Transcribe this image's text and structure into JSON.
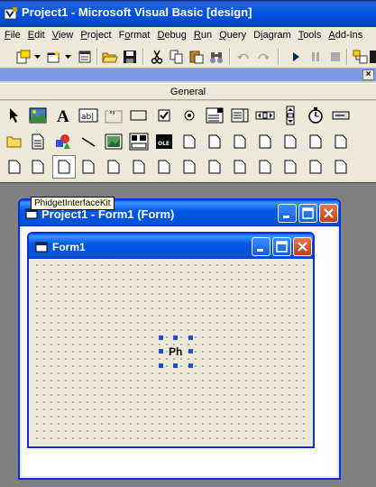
{
  "window": {
    "title": "Project1 - Microsoft Visual Basic [design]"
  },
  "menu": {
    "items": [
      {
        "label": "File",
        "ul": "F",
        "rest": "ile"
      },
      {
        "label": "Edit",
        "ul": "E",
        "rest": "dit"
      },
      {
        "label": "View",
        "ul": "V",
        "rest": "iew"
      },
      {
        "label": "Project",
        "ul": "P",
        "rest": "roject"
      },
      {
        "label": "Format",
        "ul": "o",
        "pre": "F",
        "rest": "rmat"
      },
      {
        "label": "Debug",
        "ul": "D",
        "rest": "ebug"
      },
      {
        "label": "Run",
        "ul": "R",
        "rest": "un"
      },
      {
        "label": "Query",
        "ul": "Q",
        "rest": "uery"
      },
      {
        "label": "Diagram",
        "ul": "i",
        "pre": "D",
        "rest": "agram"
      },
      {
        "label": "Tools",
        "ul": "T",
        "rest": "ools"
      },
      {
        "label": "Add-Ins",
        "ul": "A",
        "rest": "dd-Ins"
      }
    ]
  },
  "toolbox": {
    "tab_label": "General",
    "close_label": "×",
    "tooltip": "PhidgetInterfaceKit"
  },
  "project_window": {
    "title": "Project1 - Form1 (Form)"
  },
  "form_window": {
    "title": "Form1"
  },
  "control": {
    "caption": "Ph"
  },
  "colors": {
    "xp_blue": "#0054e3",
    "face": "#ece9d8",
    "workspace": "#808080",
    "handle": "#1f4fd0"
  }
}
